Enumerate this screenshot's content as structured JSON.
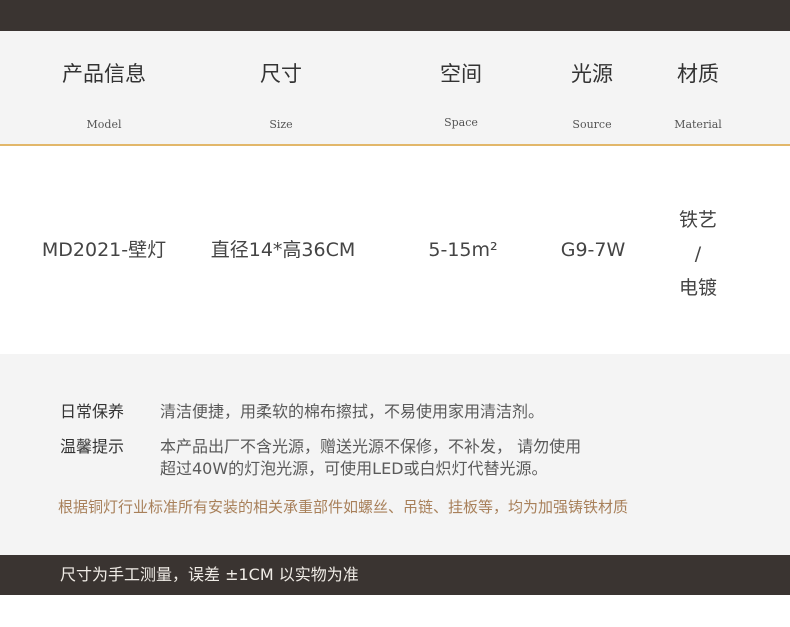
{
  "header": {
    "columns": [
      {
        "cn": "产品信息",
        "en": "Model"
      },
      {
        "cn": "尺寸",
        "en": "Size"
      },
      {
        "cn": "空间",
        "en": "Space"
      },
      {
        "cn": "光源",
        "en": "Source"
      },
      {
        "cn": "材质",
        "en": "Material"
      }
    ]
  },
  "product": {
    "model": "MD2021-壁灯",
    "size": "直径14*高36CM",
    "space": "5-15m²",
    "source": "G9-7W",
    "material_lines": [
      "铁艺",
      "/",
      "电镀"
    ]
  },
  "notes": {
    "care_label": "日常保养",
    "care_text": "清洁便捷，用柔软的棉布擦拭，不易使用家用清洁剂。",
    "tips_label": "温馨提示",
    "tips_line1": "本产品出厂不含光源，赠送光源不保修，不补发， 请勿使用",
    "tips_line2": "超过40W的灯泡光源，可使用LED或白炽灯代替光源。",
    "highlight": "根据铜灯行业标准所有安装的相关承重部件如螺丝、吊链、挂板等，均为加强铸铁材质"
  },
  "footer": {
    "text": "尺寸为手工测量，误差 ±1CM 以实物为准"
  },
  "colors": {
    "dark_band": "#3a3431",
    "gold_line": "#e2b76a",
    "highlight_text": "#a8805a"
  }
}
